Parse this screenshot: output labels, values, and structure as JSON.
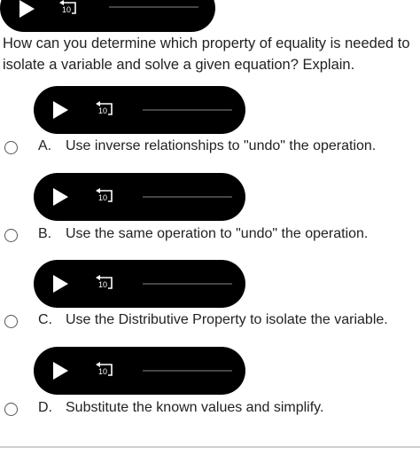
{
  "question": {
    "text": "How can you determine which property of equality is needed to isolate a variable and solve a given equation? Explain."
  },
  "players": [
    {
      "replay_label": "10"
    },
    {
      "replay_label": "10"
    },
    {
      "replay_label": "10"
    },
    {
      "replay_label": "10"
    },
    {
      "replay_label": "10"
    }
  ],
  "options": [
    {
      "letter": "A.",
      "text": "Use inverse relationships to \"undo\" the operation."
    },
    {
      "letter": "B.",
      "text": "Use the same operation to \"undo\" the operation."
    },
    {
      "letter": "C.",
      "text": "Use the Distributive Property to isolate the variable."
    },
    {
      "letter": "D.",
      "text": "Substitute the known values and simplify."
    }
  ],
  "icons": {
    "play": "play-icon",
    "replay": "replay-10-icon"
  },
  "colors": {
    "player_bg": "#000000",
    "player_fg": "#ffffff",
    "track": "#444444",
    "text": "#222222"
  }
}
